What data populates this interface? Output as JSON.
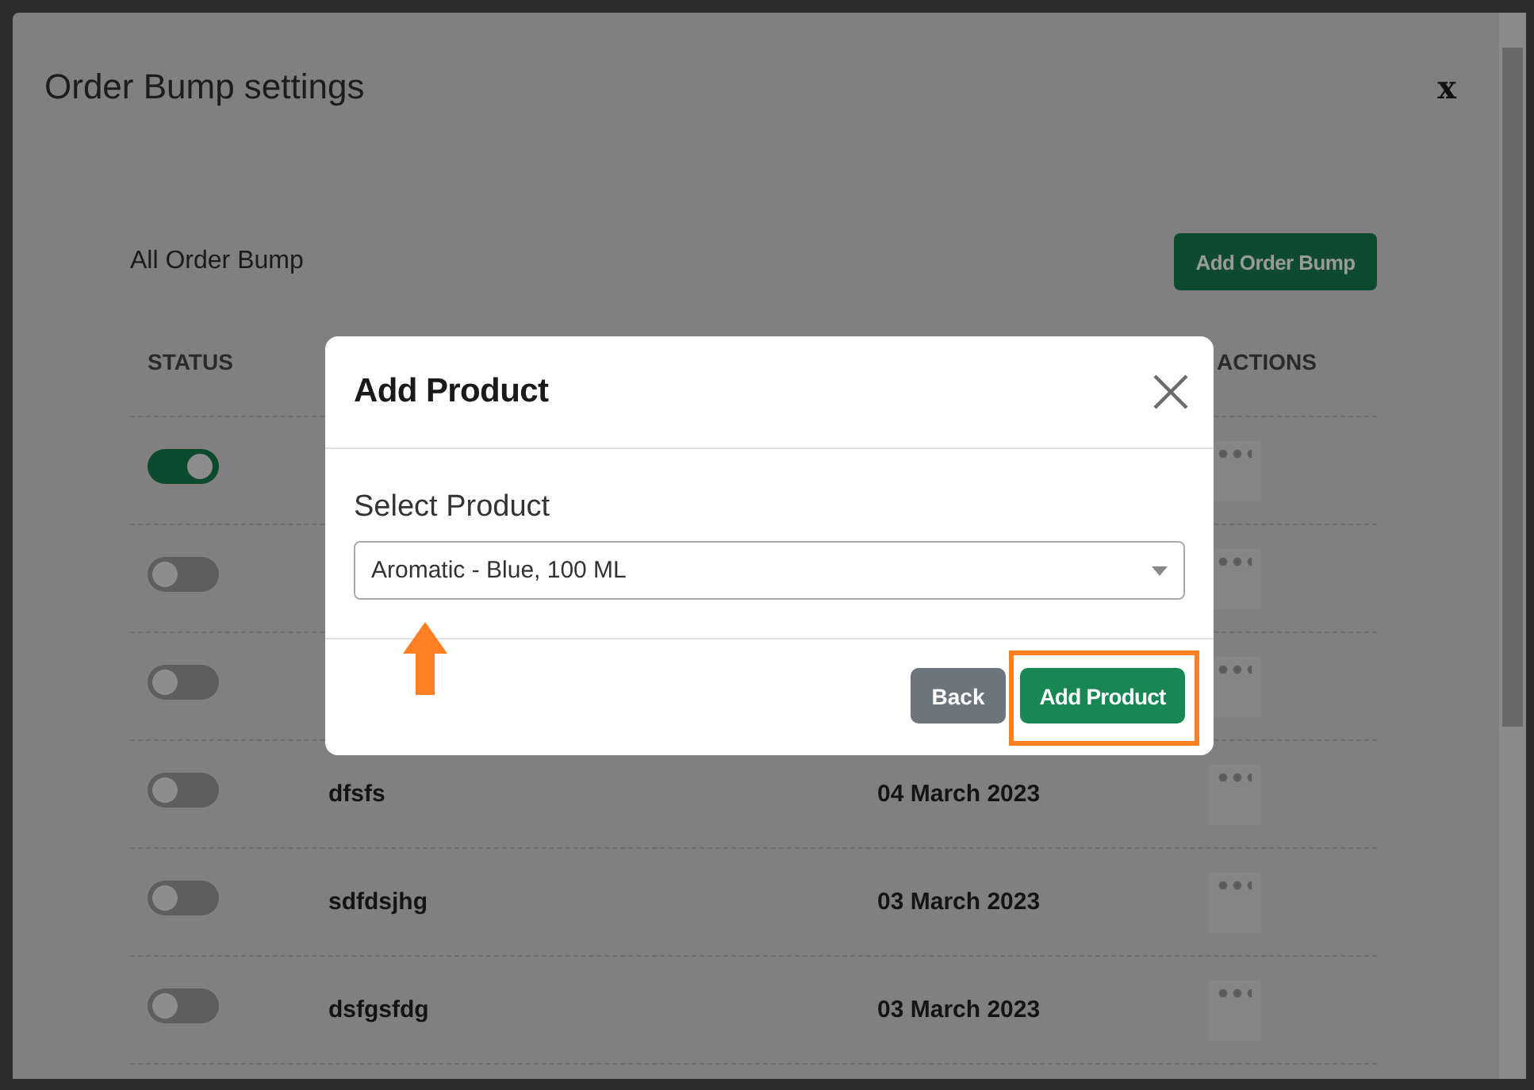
{
  "window": {
    "title": "Order Bump settings",
    "close": "x"
  },
  "toolbar": {
    "heading": "All Order Bump",
    "add_button": "Add Order Bump"
  },
  "table": {
    "status_header": "STATUS",
    "actions_header": "ACTIONS",
    "rows": [
      {
        "on": true
      },
      {
        "on": false
      },
      {
        "on": false
      },
      {
        "on": false,
        "name": "dfsfs",
        "date": "04 March 2023"
      },
      {
        "on": false,
        "name": "sdfdsjhg",
        "date": "03 March 2023"
      },
      {
        "on": false,
        "name": "dsfgsfdg",
        "date": "03 March 2023"
      }
    ]
  },
  "dialog": {
    "title": "Add Product",
    "field_label": "Select Product",
    "selected_value": "Aromatic - Blue, 100 ML",
    "back_button": "Back",
    "add_button": "Add Product"
  }
}
